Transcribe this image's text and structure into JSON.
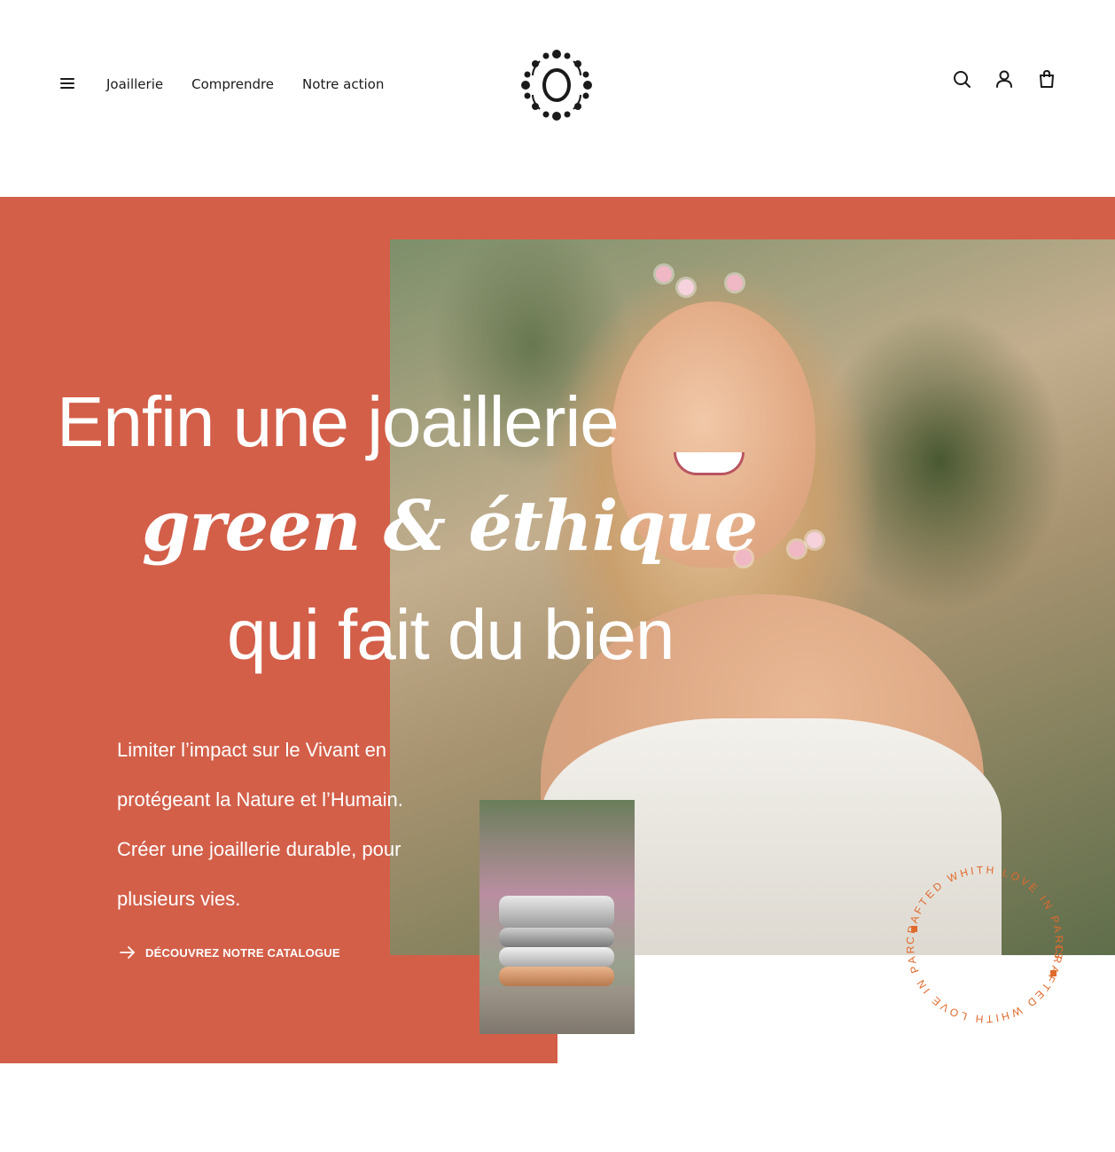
{
  "header": {
    "menu_icon": "hamburger-icon",
    "nav": [
      "Joaillerie",
      "Comprendre",
      "Notre action"
    ],
    "logo_icon": "brand-logo",
    "icons": [
      "search-icon",
      "account-icon",
      "cart-icon"
    ]
  },
  "hero": {
    "title_line1": "Enfin une joaillerie",
    "title_line2": "green & éthique",
    "title_line3": "qui fait du bien",
    "text_lines": [
      "Limiter l’impact sur le Vivant en",
      "protégeant la Nature et l’Humain.",
      "Créer une joaillerie durable, pour",
      "plusieurs vies."
    ],
    "cta_label": "DÉCOUVREZ NOTRE CATALOGUE",
    "badge_text": "CRAFTED WHITH LOVE IN PARIS",
    "accent_color": "#d35f49",
    "badge_color": "#e06a2c"
  }
}
